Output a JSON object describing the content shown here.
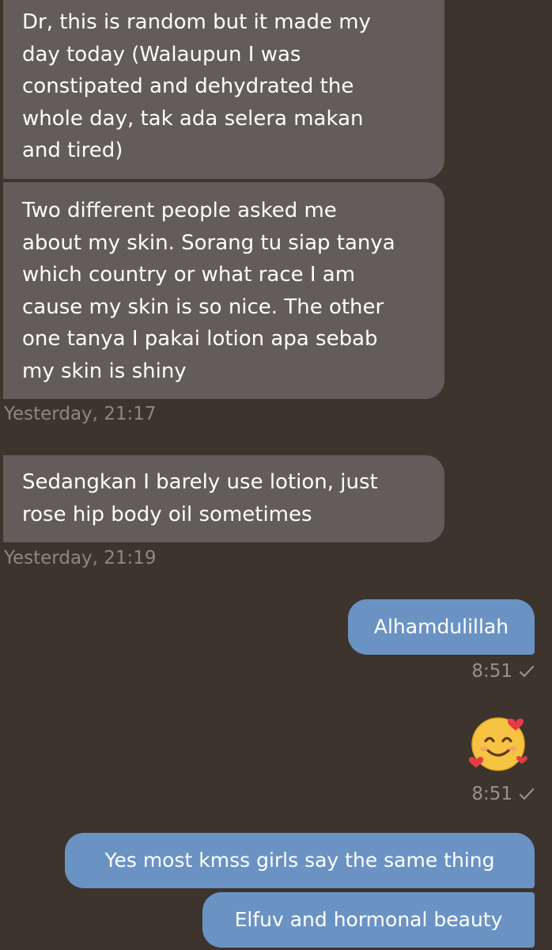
{
  "messages": {
    "m1": "Dr, this is random but it made my\nday today (Walaupun I was\nconstipated and dehydrated the\nwhole day, tak ada selera makan\nand tired)",
    "m2": "Two different people asked me\nabout my skin. Sorang tu siap tanya\nwhich country or what race I am\ncause my skin is so nice. The other\none tanya I pakai lotion apa sebab\nmy skin is shiny",
    "m2_time": "Yesterday, 21:17",
    "m3": "Sedangkan I barely use lotion, just\nrose hip body oil sometimes",
    "m3_time": "Yesterday, 21:19",
    "o1": "Alhamdulillah",
    "o1_time": "8:51",
    "o2_emoji": "smiling-face-with-hearts",
    "o2_time": "8:51",
    "o3": "Yes most kmss girls say the same thing",
    "o4": "Elfuv and hormonal beauty"
  },
  "colors": {
    "background": "#3c342d",
    "incoming_bubble": "#625d5a",
    "outgoing_bubble": "#6a93c4",
    "timestamp": "#8c8884"
  }
}
